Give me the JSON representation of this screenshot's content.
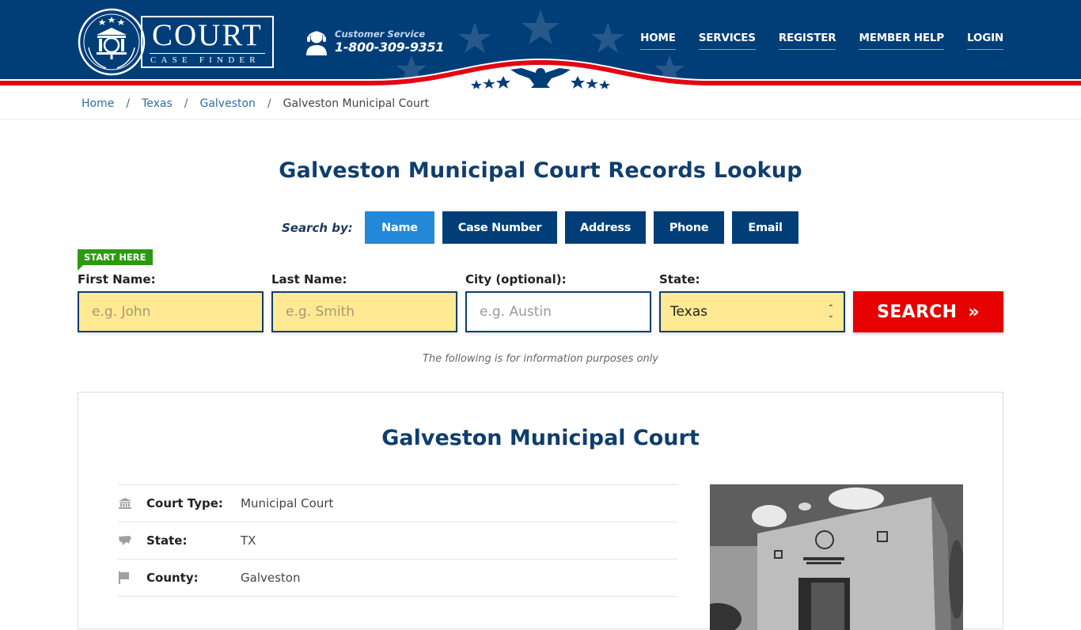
{
  "header": {
    "logo": {
      "title": "COURT",
      "subtitle": "CASE FINDER",
      "icon": "courthouse-magnifier-emblem-icon"
    },
    "customer_service": {
      "label": "Customer Service",
      "phone": "1-800-309-9351",
      "icon": "headset-agent-icon"
    },
    "nav": [
      {
        "label": "HOME"
      },
      {
        "label": "SERVICES"
      },
      {
        "label": "REGISTER"
      },
      {
        "label": "MEMBER HELP"
      },
      {
        "label": "LOGIN"
      }
    ],
    "colors": {
      "navy": "#013e78",
      "red": "#e60000"
    }
  },
  "breadcrumb": {
    "items": [
      {
        "label": "Home"
      },
      {
        "label": "Texas"
      },
      {
        "label": "Galveston"
      }
    ],
    "separator": "/",
    "current": "Galveston Municipal Court"
  },
  "main": {
    "title": "Galveston Municipal Court Records Lookup",
    "search_by": {
      "label": "Search by:",
      "tabs": [
        {
          "label": "Name",
          "active": true
        },
        {
          "label": "Case Number",
          "active": false
        },
        {
          "label": "Address",
          "active": false
        },
        {
          "label": "Phone",
          "active": false
        },
        {
          "label": "Email",
          "active": false
        }
      ]
    },
    "form": {
      "start_badge": "START HERE",
      "first_name": {
        "label": "First Name:",
        "placeholder": "e.g. John",
        "value": ""
      },
      "last_name": {
        "label": "Last Name:",
        "placeholder": "e.g. Smith",
        "value": ""
      },
      "city": {
        "label": "City (optional):",
        "placeholder": "e.g.  Austin",
        "value": ""
      },
      "state": {
        "label": "State:",
        "selected": "Texas"
      },
      "search_button": "SEARCH",
      "search_button_icon": "»"
    },
    "disclaimer": "The following is for information purposes only"
  },
  "court_card": {
    "title": "Galveston Municipal Court",
    "details": [
      {
        "icon": "courthouse-icon",
        "label": "Court Type:",
        "value": "Municipal Court"
      },
      {
        "icon": "usa-map-icon",
        "label": "State:",
        "value": "TX"
      },
      {
        "icon": "flag-icon",
        "label": "County:",
        "value": "Galveston"
      }
    ],
    "photo_alt": "Galveston Municipal Court building"
  }
}
